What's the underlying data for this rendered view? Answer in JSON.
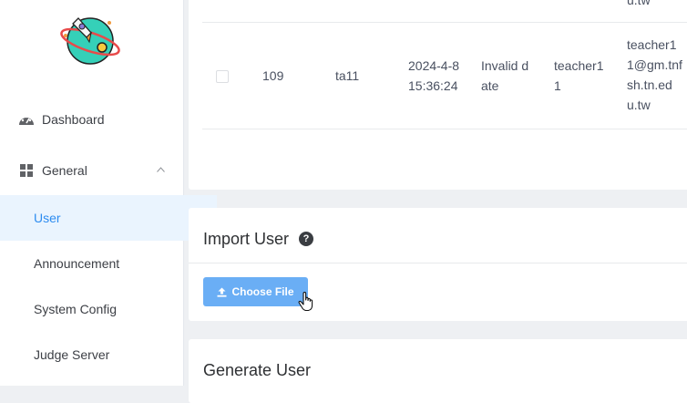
{
  "sidebar": {
    "dashboard_label": "Dashboard",
    "general_label": "General",
    "items": [
      {
        "label": "User"
      },
      {
        "label": "Announcement"
      },
      {
        "label": "System Config"
      },
      {
        "label": "Judge Server"
      }
    ]
  },
  "table": {
    "prev_row_email_tail": "u.tw",
    "row": {
      "id": "109",
      "username": "ta11",
      "create_time": "2024-4-8\n15:36:24",
      "last_login": "Invalid d\nate",
      "real_name": "teacher1\n1",
      "email": "teacher1\n1@gm.tnf\nsh.tn.ed\nu.tw"
    }
  },
  "import_user": {
    "title": "Import User",
    "help_icon": "question-circle-icon",
    "choose_file_label": "Choose File",
    "upload_icon": "upload-icon"
  },
  "generate_user": {
    "title": "Generate User"
  },
  "colors": {
    "accent": "#2d8cf0",
    "button": "#6aaef5",
    "active_bg": "#eaf4fe"
  }
}
